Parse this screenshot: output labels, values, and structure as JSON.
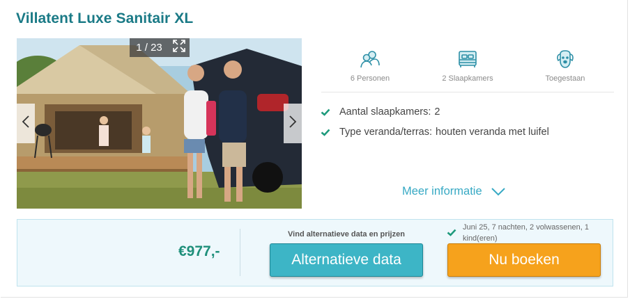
{
  "accommodation": {
    "title": "Villatent Luxe Sanitair XL"
  },
  "gallery": {
    "counter": "1 / 23",
    "current": 1,
    "total": 23
  },
  "features": [
    {
      "icon": "persons-icon",
      "label": "6 Personen"
    },
    {
      "icon": "bedroom-icon",
      "label": "2 Slaapkamers"
    },
    {
      "icon": "dog-icon",
      "label": "Toegestaan"
    }
  ],
  "specs": [
    {
      "label": "Aantal slaapkamers:",
      "value": "2"
    },
    {
      "label": "Type veranda/terras:",
      "value": "houten veranda met luifel"
    }
  ],
  "more_info": {
    "label": "Meer informatie"
  },
  "booking": {
    "price": "€977,-",
    "alt_hint": "Vind alternatieve data en prijzen",
    "alt_button": "Alternatieve data",
    "trip_summary": "Juni 25, 7 nachten, 2 volwassenen, 1 kind(eren)",
    "book_button": "Nu boeken"
  },
  "colors": {
    "title": "#1a7a86",
    "accent_teal": "#3db5c6",
    "accent_orange": "#f6a21c",
    "price_green": "#1e8f7a",
    "check_green": "#1e9a7c",
    "link_blue": "#37a9c4"
  }
}
